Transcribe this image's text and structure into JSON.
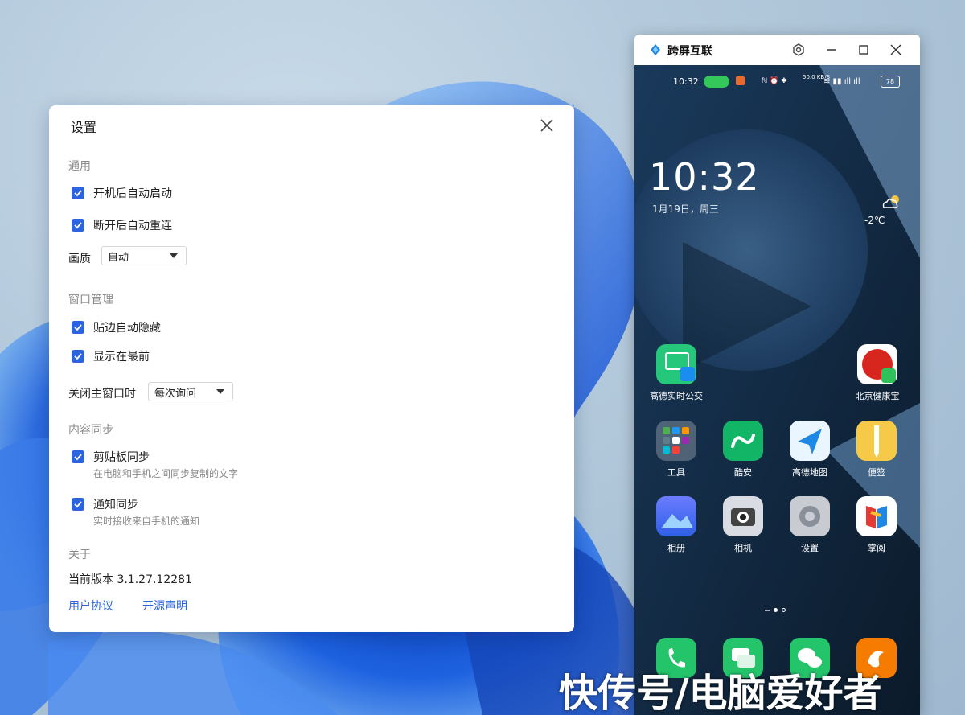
{
  "settings": {
    "title": "设置",
    "sections": {
      "general": "通用",
      "window": "窗口管理",
      "sync": "内容同步",
      "about": "关于"
    },
    "options": {
      "autostart": "开机后自动启动",
      "reconnect": "断开后自动重连",
      "autohide": "贴边自动隐藏",
      "ontop": "显示在最前",
      "clipboard": "剪贴板同步",
      "clipboard_desc": "在电脑和手机之间同步复制的文字",
      "notify": "通知同步",
      "notify_desc": "实时接收来自手机的通知"
    },
    "quality_label": "画质",
    "quality_value": "自动",
    "close_label": "关闭主窗口时",
    "close_value": "每次询问",
    "version": "当前版本 3.1.27.12281",
    "links": {
      "agreement": "用户协议",
      "opensource": "开源声明"
    }
  },
  "phone_window": {
    "title": "跨屏互联",
    "status": {
      "time": "10:32",
      "battery": "78",
      "speed": "50.0 KB/S"
    },
    "clock": "10:32",
    "date": "1月19日，周三",
    "weather": "-2℃",
    "apps_row1": [
      "高德实时公交",
      "北京健康宝"
    ],
    "apps_row2": [
      "工具",
      "酷安",
      "高德地图",
      "便签"
    ],
    "apps_row3": [
      "相册",
      "相机",
      "设置",
      "掌阅"
    ]
  },
  "watermark": "快传号/电脑爱好者",
  "colors": {
    "accent": "#2b63e0",
    "wallpaper_blue": "#1f5fd8"
  }
}
